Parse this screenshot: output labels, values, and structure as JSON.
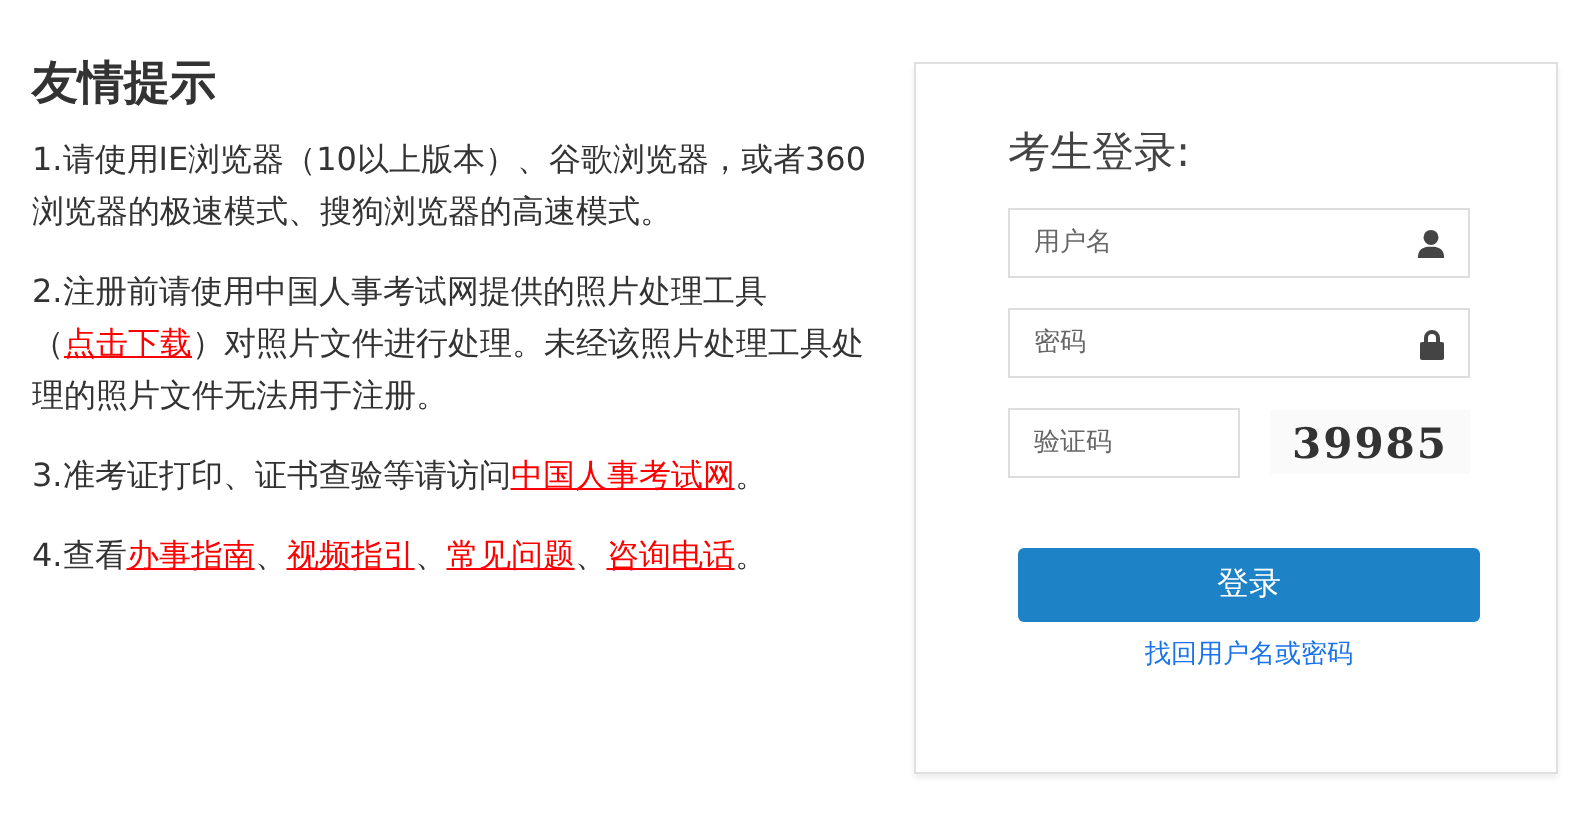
{
  "notice": {
    "title": "友情提示",
    "tips": [
      {
        "parts": [
          {
            "kind": "text",
            "text": "1.请使用IE浏览器（10以上版本）、谷歌浏览器，或者360浏览器的极速模式、搜狗浏览器的高速模式。"
          }
        ]
      },
      {
        "parts": [
          {
            "kind": "text",
            "text": "2.注册前请使用中国人事考试网提供的照片处理工具（"
          },
          {
            "kind": "link",
            "text": "点击下载"
          },
          {
            "kind": "text",
            "text": "）对照片文件进行处理。未经该照片处理工具处理的照片文件无法用于注册。"
          }
        ]
      },
      {
        "parts": [
          {
            "kind": "text",
            "text": "3.准考证打印、证书查验等请访问"
          },
          {
            "kind": "link",
            "text": "中国人事考试网"
          },
          {
            "kind": "text",
            "text": "。"
          }
        ]
      },
      {
        "parts": [
          {
            "kind": "text",
            "text": "4.查看"
          },
          {
            "kind": "link",
            "text": "办事指南"
          },
          {
            "kind": "text",
            "text": "、"
          },
          {
            "kind": "link",
            "text": "视频指引"
          },
          {
            "kind": "text",
            "text": "、"
          },
          {
            "kind": "link",
            "text": "常见问题"
          },
          {
            "kind": "text",
            "text": "、"
          },
          {
            "kind": "link",
            "text": "咨询电话"
          },
          {
            "kind": "text",
            "text": "。"
          }
        ]
      }
    ]
  },
  "login": {
    "title": "考生登录:",
    "fields": [
      {
        "kind": "username",
        "placeholder": "用户名"
      },
      {
        "kind": "password",
        "placeholder": "密码"
      },
      {
        "kind": "captcha",
        "placeholder": "验证码",
        "captcha": "39985"
      }
    ],
    "button": "登录",
    "forgot_link": "找回用户名或密码"
  }
}
